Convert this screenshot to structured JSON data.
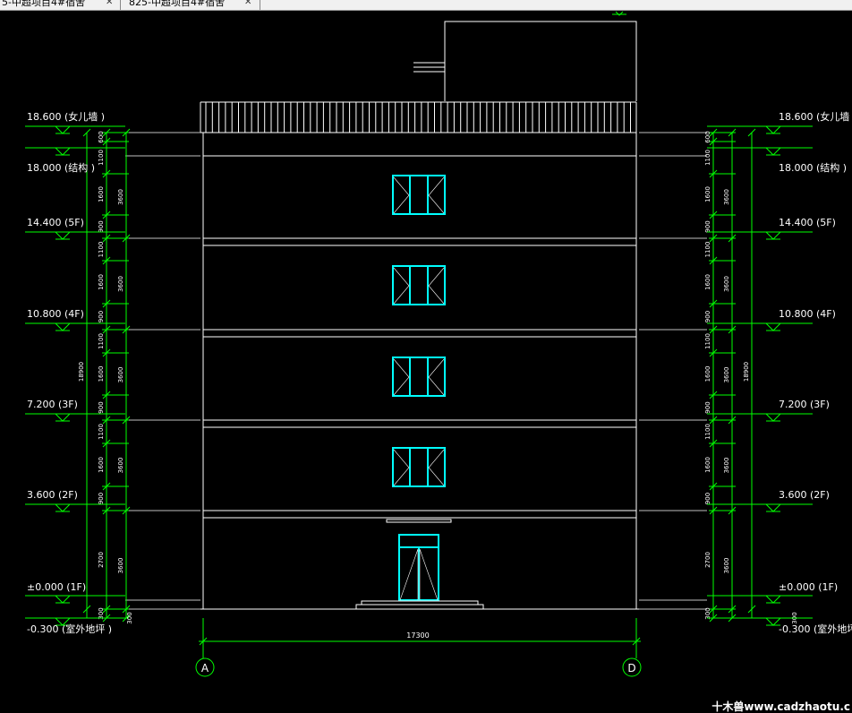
{
  "tabs": [
    {
      "label": "5-中超项目4#宿舍"
    },
    {
      "label": "825-中超项目4#宿舍"
    }
  ],
  "colors": {
    "background": "#000000",
    "line_white": "#ffffff",
    "line_green": "#00ff00",
    "window_cyan": "#00ffff",
    "axis_circle": "#00ff00"
  },
  "elevation_labels_left": [
    {
      "text": "18.600 (女儿墙 )"
    },
    {
      "text": "18.000 (结构 )"
    },
    {
      "text": "14.400 (5F)"
    },
    {
      "text": "10.800 (4F)"
    },
    {
      "text": "7.200 (3F)"
    },
    {
      "text": "3.600 (2F)"
    },
    {
      "text": "±0.000 (1F)"
    },
    {
      "text": "-0.300 (室外地坪 )"
    }
  ],
  "elevation_labels_right": [
    {
      "text": "18.600 (女儿墙"
    },
    {
      "text": "18.000 (结构 )"
    },
    {
      "text": "14.400 (5F)"
    },
    {
      "text": "10.800 (4F)"
    },
    {
      "text": "7.200 (3F)"
    },
    {
      "text": "3.600 (2F)"
    },
    {
      "text": "±0.000 (1F)"
    },
    {
      "text": "-0.300 (室外地坪"
    }
  ],
  "dimensions_segments": [
    "600",
    "1100",
    "1600",
    "900",
    "1100",
    "1600",
    "900",
    "1100",
    "1600",
    "900",
    "1100",
    "1600",
    "900",
    "2700",
    "300"
  ],
  "dimensions_storey": [
    "3600",
    "3600",
    "3600",
    "3600",
    "3600"
  ],
  "dimension_total_height": "18900",
  "dimension_bottom_300": "300",
  "dimension_total_width": "17300",
  "axis_labels": {
    "left": "A",
    "right": "D"
  },
  "watermark": "十木兽www.cadzhaotu.c"
}
